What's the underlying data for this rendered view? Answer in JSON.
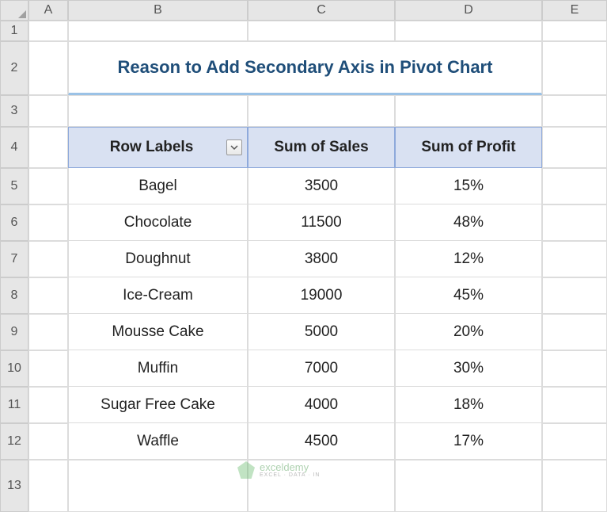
{
  "columns": [
    "A",
    "B",
    "C",
    "D",
    "E"
  ],
  "rows": [
    "1",
    "2",
    "3",
    "4",
    "5",
    "6",
    "7",
    "8",
    "9",
    "10",
    "11",
    "12",
    "13"
  ],
  "title": "Reason to Add Secondary Axis in Pivot Chart",
  "headers": {
    "row_labels": "Row Labels",
    "sum_sales": "Sum of Sales",
    "sum_profit": "Sum of Profit"
  },
  "data": [
    {
      "label": "Bagel",
      "sales": "3500",
      "profit": "15%"
    },
    {
      "label": "Chocolate",
      "sales": "11500",
      "profit": "48%"
    },
    {
      "label": "Doughnut",
      "sales": "3800",
      "profit": "12%"
    },
    {
      "label": "Ice-Cream",
      "sales": "19000",
      "profit": "45%"
    },
    {
      "label": "Mousse Cake",
      "sales": "5000",
      "profit": "20%"
    },
    {
      "label": "Muffin",
      "sales": "7000",
      "profit": "30%"
    },
    {
      "label": "Sugar Free Cake",
      "sales": "4000",
      "profit": "18%"
    },
    {
      "label": "Waffle",
      "sales": "4500",
      "profit": "17%"
    }
  ],
  "watermark": {
    "brand": "exceldemy",
    "tagline": "EXCEL · DATA · IN"
  },
  "chart_data": {
    "type": "table",
    "title": "Reason to Add Secondary Axis in Pivot Chart",
    "categories": [
      "Bagel",
      "Chocolate",
      "Doughnut",
      "Ice-Cream",
      "Mousse Cake",
      "Muffin",
      "Sugar Free Cake",
      "Waffle"
    ],
    "series": [
      {
        "name": "Sum of Sales",
        "values": [
          3500,
          11500,
          3800,
          19000,
          5000,
          7000,
          4000,
          4500
        ]
      },
      {
        "name": "Sum of Profit",
        "values": [
          0.15,
          0.48,
          0.12,
          0.45,
          0.2,
          0.3,
          0.18,
          0.17
        ]
      }
    ]
  }
}
